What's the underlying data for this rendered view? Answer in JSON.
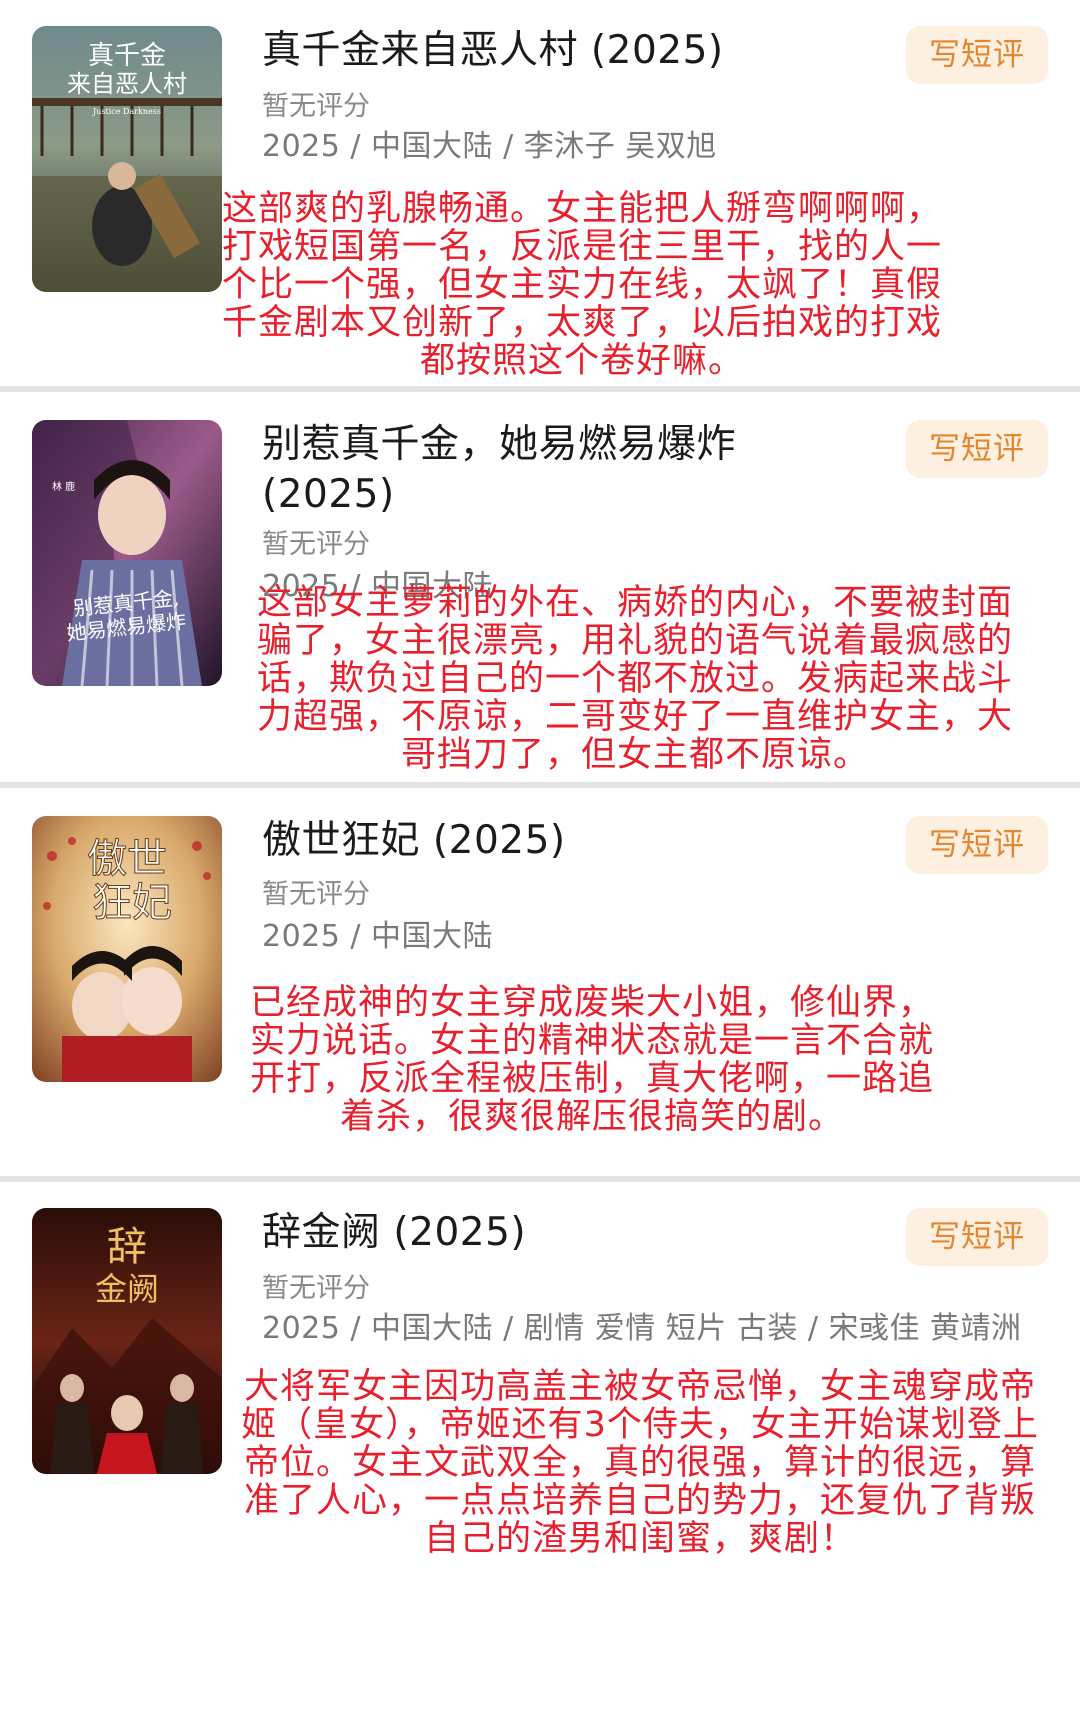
{
  "items": [
    {
      "title": "真千金来自恶人村",
      "year": "(2025)",
      "rating": "暂无评分",
      "meta": "2025 / 中国大陆 / 李沐子 吴双旭",
      "button": "写短评",
      "review": "这部爽的乳腺畅通。女主能把人掰弯啊啊啊，打戏短国第一名，反派是往三里干，找的人一个比一个强，但女主实力在线，太飒了！真假千金剧本又创新了，太爽了，以后拍戏的打戏都按照这个卷好嘛。",
      "poster": {
        "line1": "真千金",
        "line2": "来自恶人村",
        "sub": "Justice Darkness",
        "colors": [
          "#3d5560",
          "#6a7a6e",
          "#2c3330"
        ]
      }
    },
    {
      "title": "别惹真千金，她易燃易爆炸",
      "year": "(2025)",
      "rating": "暂无评分",
      "meta": "2025 / 中国大陆",
      "button": "写短评",
      "review": "这部女主萝莉的外在、病娇的内心，不要被封面骗了，女主很漂亮，用礼貌的语气说着最疯感的话，欺负过自己的一个都不放过。发病起来战斗力超强，不原谅，二哥变好了一直维护女主，大哥挡刀了，但女主都不原谅。",
      "poster": {
        "line1": "别惹真千金,",
        "line2": "她易燃易爆炸",
        "sub": "林 鹿",
        "colors": [
          "#6b3a6e",
          "#b06aa0",
          "#2a1b35"
        ]
      }
    },
    {
      "title": "傲世狂妃",
      "year": "(2025)",
      "rating": "暂无评分",
      "meta": "2025 / 中国大陆",
      "button": "写短评",
      "review": "已经成神的女主穿成废柴大小姐，修仙界，实力说话。女主的精神状态就是一言不合就开打，反派全程被压制，真大佬啊，一路追着杀，很爽很解压很搞笑的剧。",
      "poster": {
        "line1": "傲世",
        "line2": "狂妃",
        "sub": "",
        "colors": [
          "#d8a86a",
          "#f1d3a0",
          "#7a2b24"
        ]
      }
    },
    {
      "title": "辞金阙",
      "year": "(2025)",
      "rating": "暂无评分",
      "meta": "2025 / 中国大陆 / 剧情 爱情 短片 古装 / 宋彧佳 黄靖洲",
      "button": "写短评",
      "review": "大将军女主因功高盖主被女帝忌惮，女主魂穿成帝姬（皇女），帝姬还有3个侍夫，女主开始谋划登上帝位。女主文武双全，真的很强，算计的很远，算准了人心，一点点培养自己的势力，还复仇了背叛自己的渣男和闺蜜，爽剧！",
      "poster": {
        "line1": "辞",
        "line2": "金阙",
        "sub": "",
        "colors": [
          "#3a1510",
          "#7a2a1c",
          "#150806"
        ]
      }
    }
  ]
}
